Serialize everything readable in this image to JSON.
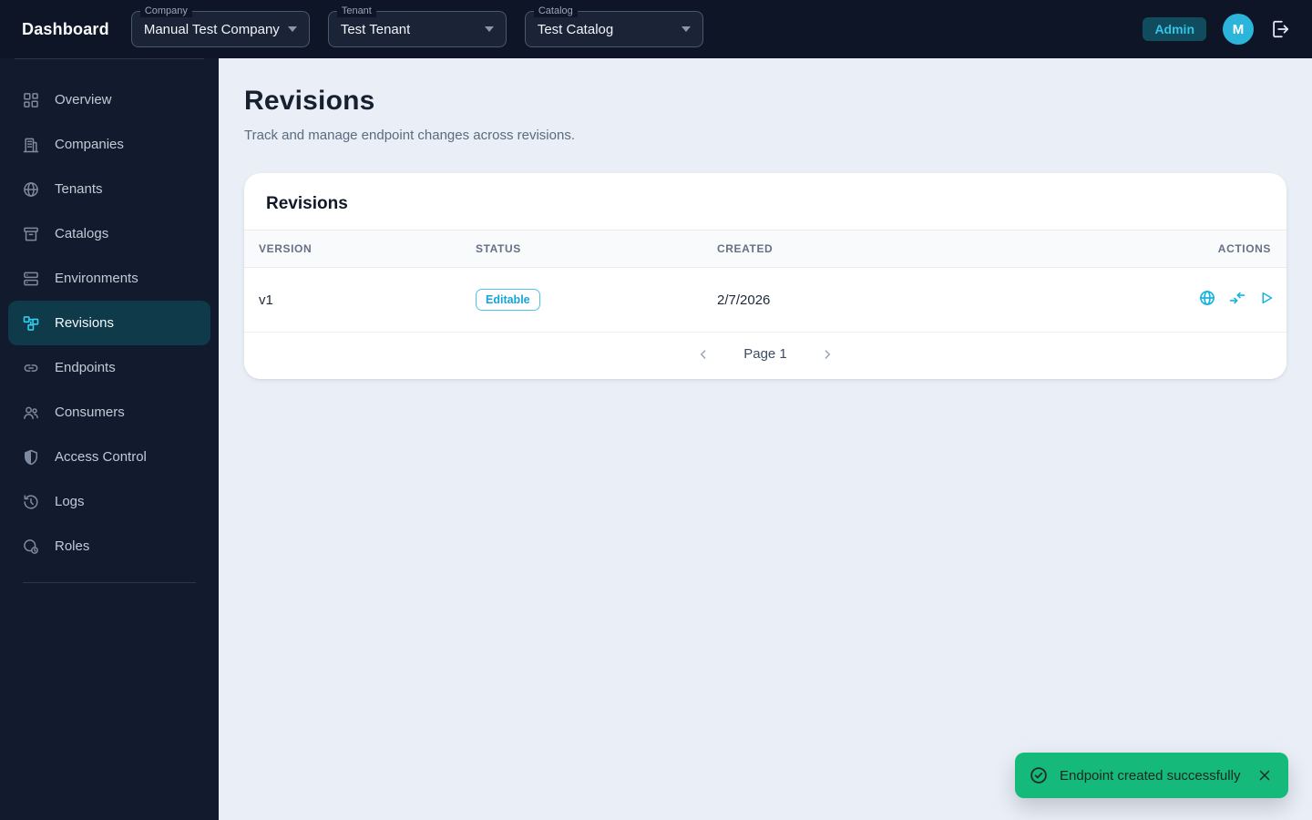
{
  "header": {
    "brand": "Dashboard",
    "company": {
      "label": "Company",
      "value": "Manual Test Company"
    },
    "tenant": {
      "label": "Tenant",
      "value": "Test Tenant"
    },
    "catalog": {
      "label": "Catalog",
      "value": "Test Catalog"
    },
    "role_badge": "Admin",
    "avatar_initial": "M"
  },
  "sidebar": {
    "items": [
      {
        "label": "Overview",
        "icon": "layout-grid-icon",
        "active": false
      },
      {
        "label": "Companies",
        "icon": "building-icon",
        "active": false
      },
      {
        "label": "Tenants",
        "icon": "globe-icon",
        "active": false
      },
      {
        "label": "Catalogs",
        "icon": "archive-box-icon",
        "active": false
      },
      {
        "label": "Environments",
        "icon": "server-stack-icon",
        "active": false
      },
      {
        "label": "Revisions",
        "icon": "workflow-icon",
        "active": true
      },
      {
        "label": "Endpoints",
        "icon": "link-icon",
        "active": false
      },
      {
        "label": "Consumers",
        "icon": "users-icon",
        "active": false
      },
      {
        "label": "Access Control",
        "icon": "shield-icon",
        "active": false
      },
      {
        "label": "Logs",
        "icon": "history-icon",
        "active": false
      },
      {
        "label": "Roles",
        "icon": "role-badge-icon",
        "active": false
      }
    ]
  },
  "page": {
    "title": "Revisions",
    "subtitle": "Track and manage endpoint changes across revisions."
  },
  "card": {
    "title": "Revisions",
    "columns": {
      "version": "VERSION",
      "status": "STATUS",
      "created": "CREATED",
      "actions": "ACTIONS"
    },
    "rows": [
      {
        "version": "v1",
        "status": "Editable",
        "created": "2/7/2026"
      }
    ],
    "row_action_icons": [
      "globe-icon",
      "swap-arrows-icon",
      "play-icon"
    ],
    "pagination": {
      "label": "Page 1"
    }
  },
  "toast": {
    "message": "Endpoint created successfully",
    "icon": "check-circle-icon"
  },
  "colors": {
    "accent_cyan": "#14b4e0",
    "success_green": "#15b979",
    "active_nav_bg": "#0e3a49",
    "navbar_bg": "#0d1526",
    "sidebar_bg": "#121b2d",
    "main_bg": "#e9eef7"
  }
}
